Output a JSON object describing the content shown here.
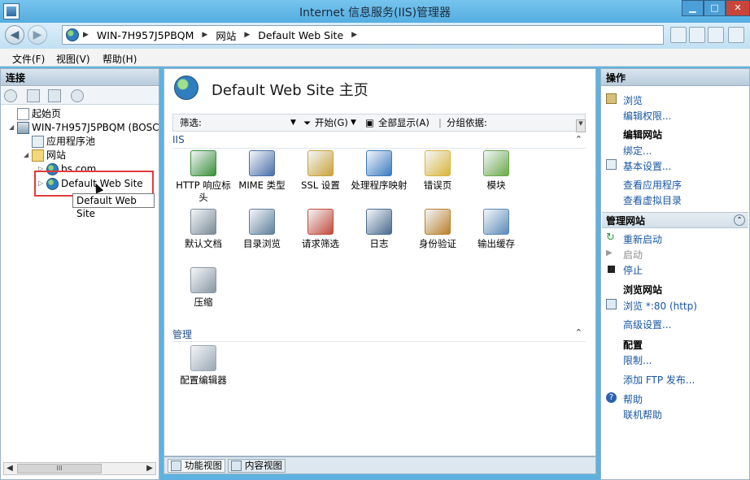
{
  "window": {
    "title": "Internet 信息服务(IIS)管理器",
    "min": "▁",
    "max": "□",
    "close": "✕"
  },
  "nav": {
    "back": "◀",
    "forward": "▶",
    "address": [
      "WIN-7H957J5PBQM",
      "网站",
      "Default Web Site"
    ]
  },
  "menu": [
    "文件(F)",
    "视图(V)",
    "帮助(H)"
  ],
  "left": {
    "header": "连接",
    "tree": [
      {
        "label": "起始页",
        "icon": "start-page-icon"
      },
      {
        "label": "WIN-7H957J5PBQM (BOSC",
        "icon": "server-icon"
      },
      {
        "label": "应用程序池",
        "icon": "app-pool-icon"
      },
      {
        "label": "网站",
        "icon": "sites-folder-icon"
      },
      {
        "label": "bs.com",
        "icon": "globe-icon"
      },
      {
        "label": "Default Web Site",
        "icon": "globe-icon"
      }
    ],
    "tooltip": "Default Web Site",
    "scroll_thumb": "III"
  },
  "center": {
    "title": "Default Web Site 主页",
    "filter": {
      "label": "筛选:",
      "start": "开始(G)",
      "show_all": "全部显示(A)",
      "group_by": "分组依据:"
    },
    "sections": [
      {
        "name": "IIS",
        "features": [
          {
            "label": "HTTP 响应标头",
            "icon": "http-headers-icon",
            "color": "#3a8f3a"
          },
          {
            "label": "MIME 类型",
            "icon": "mime-types-icon",
            "color": "#4a6fa8"
          },
          {
            "label": "SSL 设置",
            "icon": "lock-icon",
            "color": "#c9a23a"
          },
          {
            "label": "处理程序映射",
            "icon": "handler-mappings-icon",
            "color": "#3b7bbf"
          },
          {
            "label": "错误页",
            "icon": "error-pages-icon",
            "color": "#d8b53a"
          },
          {
            "label": "模块",
            "icon": "modules-icon",
            "color": "#6aa84a"
          },
          {
            "label": "默认文档",
            "icon": "default-document-icon",
            "color": "#7a8a96"
          },
          {
            "label": "目录浏览",
            "icon": "directory-browsing-icon",
            "color": "#5f7f9a"
          },
          {
            "label": "请求筛选",
            "icon": "request-filtering-icon",
            "color": "#c24a3a"
          },
          {
            "label": "日志",
            "icon": "logging-icon",
            "color": "#4a6b8f"
          },
          {
            "label": "身份验证",
            "icon": "authentication-icon",
            "color": "#b8802a"
          },
          {
            "label": "输出缓存",
            "icon": "output-caching-icon",
            "color": "#5a8ab8"
          },
          {
            "label": "压缩",
            "icon": "compression-icon",
            "color": "#8a96a2"
          }
        ]
      },
      {
        "name": "管理",
        "features": [
          {
            "label": "配置编辑器",
            "icon": "configuration-editor-icon",
            "color": "#9aa6b2"
          }
        ]
      }
    ],
    "tabs": [
      "功能视图",
      "内容视图"
    ]
  },
  "right": {
    "header": "操作",
    "top_actions": [
      "浏览",
      "编辑权限..."
    ],
    "edit_site": {
      "title": "编辑网站",
      "items": [
        "绑定...",
        "基本设置...",
        "查看应用程序",
        "查看虚拟目录"
      ]
    },
    "manage": {
      "title": "管理网站",
      "restart": "重新启动",
      "start": "启动",
      "stop": "停止",
      "browse_title": "浏览网站",
      "browse_80": "浏览 *:80 (http)",
      "advanced": "高级设置...",
      "config_title": "配置",
      "limits": "限制...",
      "ftp": "添加 FTP 发布...",
      "help": "帮助",
      "online_help": "联机帮助"
    }
  }
}
